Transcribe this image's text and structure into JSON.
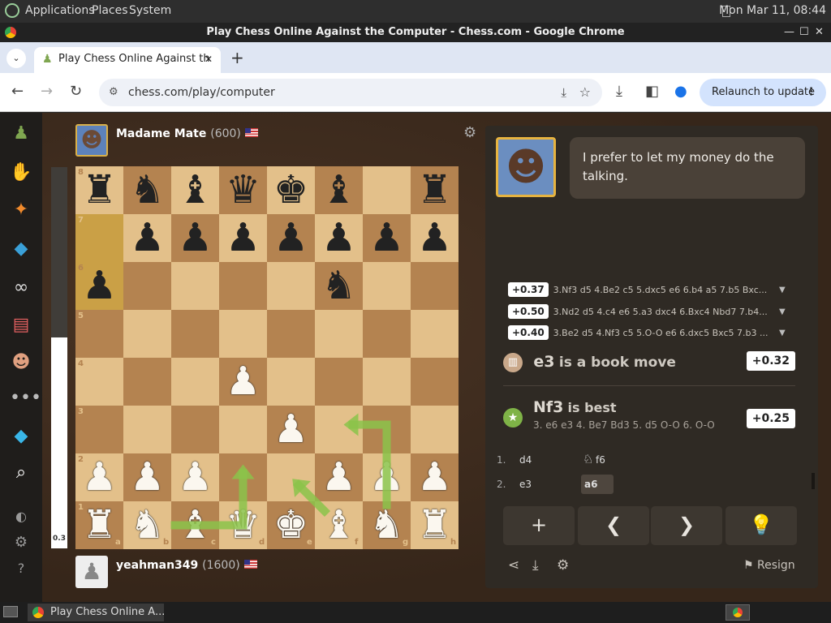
{
  "desktop": {
    "menus": [
      "Applications",
      "Places",
      "System"
    ],
    "clock": "Mon Mar 11, 08:44"
  },
  "window": {
    "title": "Play Chess Online Against the Computer - Chess.com - Google Chrome"
  },
  "browser": {
    "tab_title": "Play Chess Online Against th",
    "url": "chess.com/play/computer",
    "relaunch_label": "Relaunch to update"
  },
  "opponent": {
    "name": "Madame Mate",
    "rating": "(600)"
  },
  "player": {
    "name": "yeahman349",
    "rating": "(1600)"
  },
  "eval_bar": {
    "value_label": "0.3"
  },
  "board": {
    "files": [
      "a",
      "b",
      "c",
      "d",
      "e",
      "f",
      "g",
      "h"
    ],
    "ranks": [
      "8",
      "7",
      "6",
      "5",
      "4",
      "3",
      "2",
      "1"
    ],
    "pieces": [
      {
        "sq": "a8",
        "glyph": "♜",
        "side": "b"
      },
      {
        "sq": "b8",
        "glyph": "♞",
        "side": "b"
      },
      {
        "sq": "c8",
        "glyph": "♝",
        "side": "b"
      },
      {
        "sq": "d8",
        "glyph": "♛",
        "side": "b"
      },
      {
        "sq": "e8",
        "glyph": "♚",
        "side": "b"
      },
      {
        "sq": "f8",
        "glyph": "♝",
        "side": "b"
      },
      {
        "sq": "h8",
        "glyph": "♜",
        "side": "b"
      },
      {
        "sq": "b7",
        "glyph": "♟",
        "side": "b"
      },
      {
        "sq": "c7",
        "glyph": "♟",
        "side": "b"
      },
      {
        "sq": "d7",
        "glyph": "♟",
        "side": "b"
      },
      {
        "sq": "e7",
        "glyph": "♟",
        "side": "b"
      },
      {
        "sq": "f7",
        "glyph": "♟",
        "side": "b"
      },
      {
        "sq": "g7",
        "glyph": "♟",
        "side": "b"
      },
      {
        "sq": "h7",
        "glyph": "♟",
        "side": "b"
      },
      {
        "sq": "a6",
        "glyph": "♟",
        "side": "b"
      },
      {
        "sq": "f6",
        "glyph": "♞",
        "side": "b"
      },
      {
        "sq": "d4",
        "glyph": "♟",
        "side": "w"
      },
      {
        "sq": "e3",
        "glyph": "♟",
        "side": "w"
      },
      {
        "sq": "a2",
        "glyph": "♟",
        "side": "w"
      },
      {
        "sq": "b2",
        "glyph": "♟",
        "side": "w"
      },
      {
        "sq": "c2",
        "glyph": "♟",
        "side": "w"
      },
      {
        "sq": "f2",
        "glyph": "♟",
        "side": "w"
      },
      {
        "sq": "g2",
        "glyph": "♟",
        "side": "w"
      },
      {
        "sq": "h2",
        "glyph": "♟",
        "side": "w"
      },
      {
        "sq": "a1",
        "glyph": "♜",
        "side": "w"
      },
      {
        "sq": "b1",
        "glyph": "♞",
        "side": "w"
      },
      {
        "sq": "c1",
        "glyph": "♝",
        "side": "w"
      },
      {
        "sq": "d1",
        "glyph": "♛",
        "side": "w"
      },
      {
        "sq": "e1",
        "glyph": "♚",
        "side": "w"
      },
      {
        "sq": "f1",
        "glyph": "♝",
        "side": "w"
      },
      {
        "sq": "g1",
        "glyph": "♞",
        "side": "w"
      },
      {
        "sq": "h1",
        "glyph": "♜",
        "side": "w"
      }
    ],
    "highlighted": [
      "a7",
      "a6"
    ],
    "arrow_color": "#8bc34a"
  },
  "coach": {
    "message": "I prefer to let my money do the talking."
  },
  "engine_lines": [
    {
      "score": "+0.37",
      "line": "3.Nf3 d5 4.Be2 c5 5.dxc5 e6 6.b4 a5 7.b5 Bxc..."
    },
    {
      "score": "+0.50",
      "line": "3.Nd2 d5 4.c4 e6 5.a3 dxc4 6.Bxc4 Nbd7 7.b4..."
    },
    {
      "score": "+0.40",
      "line": "3.Be2 d5 4.Nf3 c5 5.O-O e6 6.dxc5 Bxc5 7.b3 ..."
    }
  ],
  "book_move": {
    "move": "e3",
    "text": "is a book move",
    "score": "+0.32"
  },
  "best_move": {
    "move": "Nf3",
    "text": "is best",
    "line": "3. e6 e3 4. Be7 Bd3 5. d5 O-O 6. O-O",
    "score": "+0.25"
  },
  "move_list": [
    {
      "num": "1.",
      "white": "d4",
      "black": "f6",
      "black_icon": "knight-icon"
    },
    {
      "num": "2.",
      "white": "e3",
      "black": "a6"
    }
  ],
  "controls": {
    "resign_label": "Resign"
  },
  "taskbar": {
    "item_label": "Play Chess Online A..."
  }
}
